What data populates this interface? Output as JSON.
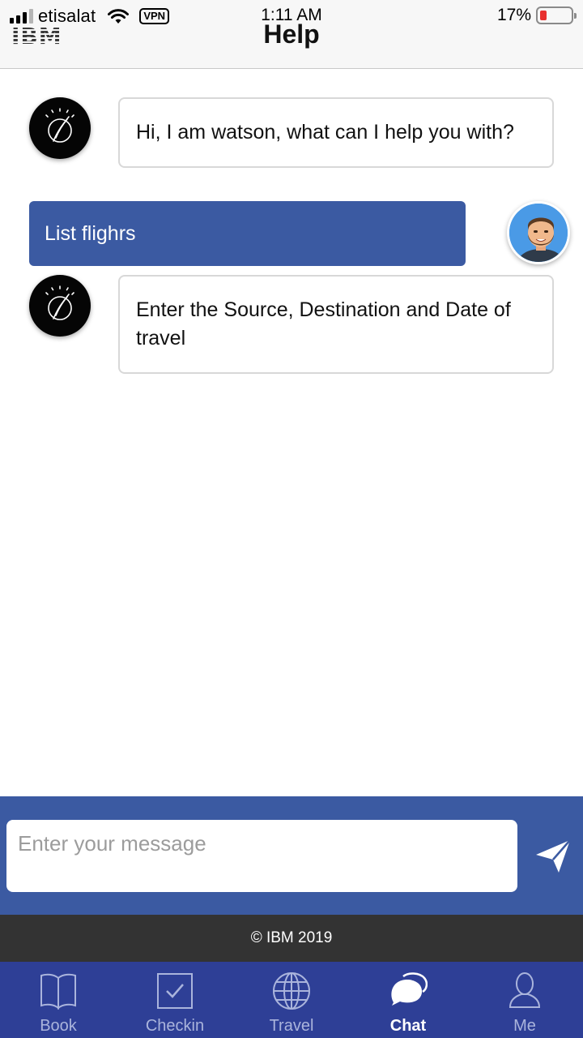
{
  "status_bar": {
    "carrier": "etisalat",
    "vpn": "VPN",
    "time": "1:11 AM",
    "battery": "17%",
    "battery_level": 0.17
  },
  "header": {
    "logo": "IBM",
    "title": "Help"
  },
  "chat": {
    "messages": [
      {
        "from": "bot",
        "text": "Hi, I am watson, what can I help you with?"
      },
      {
        "from": "user",
        "text": "List flighrs"
      },
      {
        "from": "bot",
        "text": "Enter the Source, Destination and Date of travel"
      }
    ]
  },
  "composer": {
    "placeholder": "Enter your message",
    "value": ""
  },
  "footer": {
    "text": "© IBM 2019"
  },
  "tabs": [
    {
      "label": "Book",
      "icon": "book-icon",
      "active": false
    },
    {
      "label": "Checkin",
      "icon": "checkbox-icon",
      "active": false
    },
    {
      "label": "Travel",
      "icon": "globe-icon",
      "active": false
    },
    {
      "label": "Chat",
      "icon": "chat-bubbles-icon",
      "active": true
    },
    {
      "label": "Me",
      "icon": "user-icon",
      "active": false
    }
  ],
  "colors": {
    "primary": "#3b5aa2",
    "tabbar": "#2e3f96",
    "footer": "#333333",
    "battery_low": "#e8302f"
  }
}
